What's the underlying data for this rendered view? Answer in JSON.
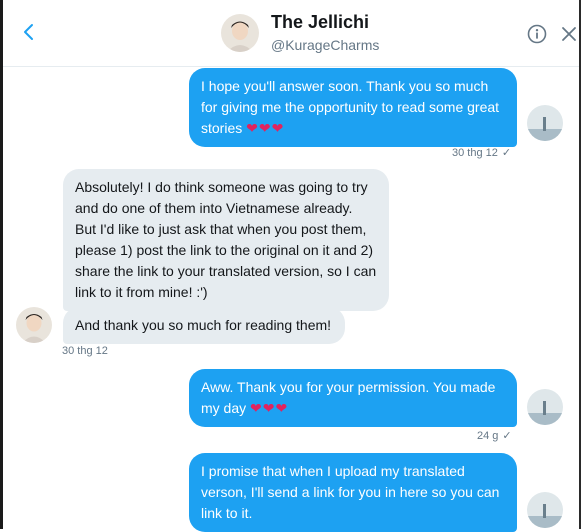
{
  "header": {
    "name": "The Jellichi",
    "handle": "@KurageCharms",
    "back_icon": "chevron-left-icon",
    "info_icon": "info-icon",
    "close_icon": "close-icon"
  },
  "messages": [
    {
      "direction": "out",
      "text": "I hope you'll answer soon. Thank you so much for giving me the opportunity to read some great stories",
      "hearts": "❤❤❤",
      "timestamp": "30 thg 12",
      "status": "✓"
    },
    {
      "direction": "in",
      "text": "Absolutely! I do think someone was going to try and do one of them into Vietnamese already. But I'd like to just ask that when you post them, please 1) post the link to the original on it and 2) share the link to your translated version, so I can link to it from mine! :')"
    },
    {
      "direction": "in",
      "text": "And thank you so much for reading them!",
      "timestamp": "30 thg 12"
    },
    {
      "direction": "out",
      "text": "Aww. Thank you for your permission. You made my day",
      "hearts": "❤❤❤",
      "timestamp": "24 g",
      "status": "✓"
    },
    {
      "direction": "out",
      "text": "I promise that when I upload my translated verson, I'll send a link for you in here so you can link to it."
    }
  ],
  "colors": {
    "accent": "#1da1f2",
    "incoming_bg": "#e6ecf0",
    "heart": "#e0245e",
    "muted": "#657786"
  }
}
